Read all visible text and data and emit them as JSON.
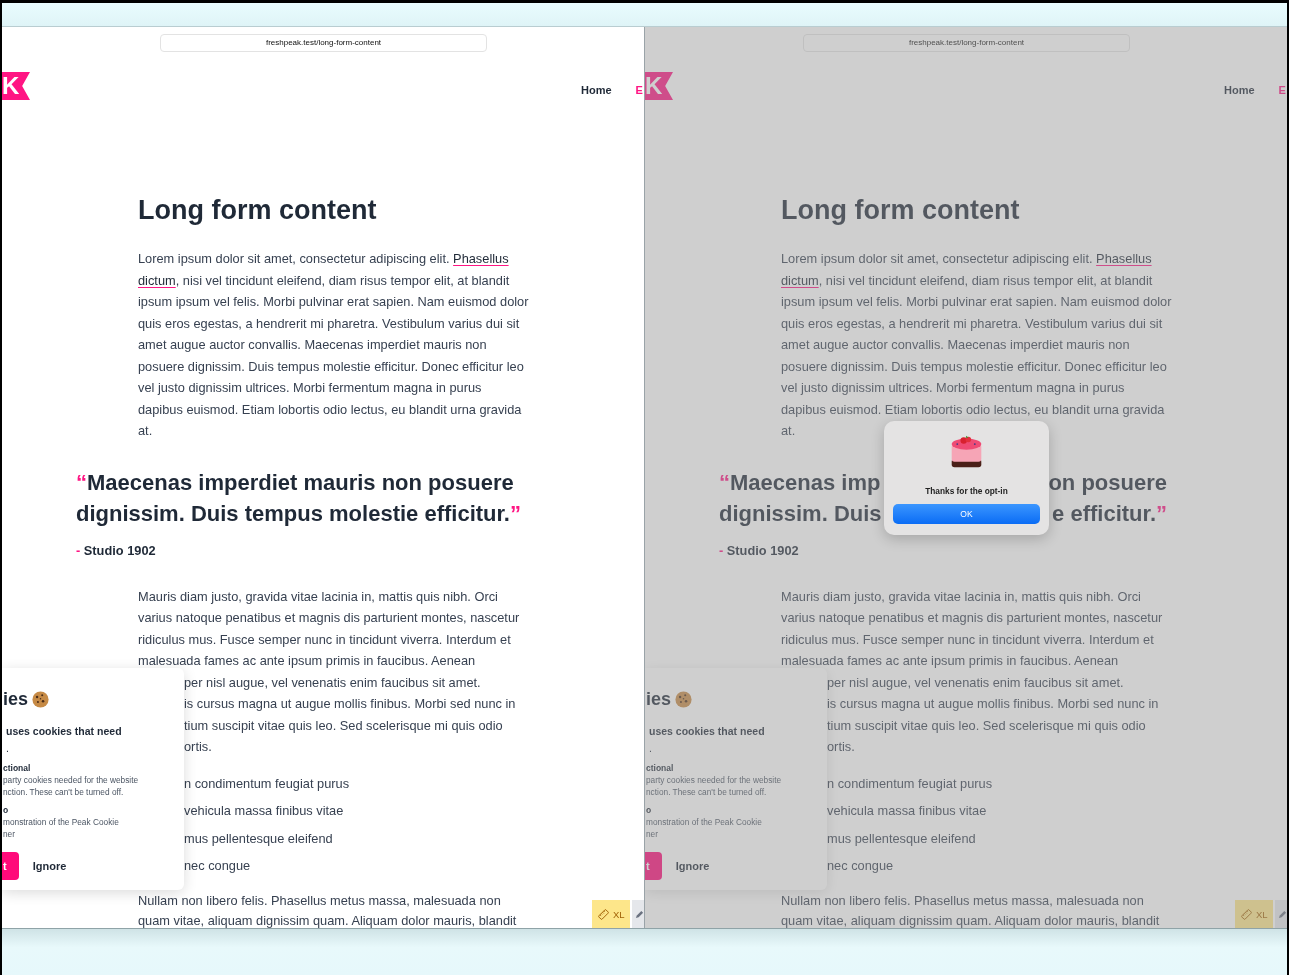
{
  "panes": [
    {
      "dimmed": false,
      "url": "freshpeak.test/long-form-content",
      "logo": "K",
      "nav": [
        {
          "label": "Home",
          "kind": "plain"
        },
        {
          "label": "E",
          "kind": "accent"
        }
      ],
      "title": "Long form content",
      "intro": [
        [
          {
            "text": "Lorem ipsum dolor sit amet, consectetur adipiscing elit. ",
            "link": false
          },
          {
            "text": "Phasellus",
            "link": true
          }
        ],
        [
          {
            "text": "dictum",
            "link": true
          },
          {
            "text": ", nisi vel tincidunt eleifend, diam risus tempor elit, at blandit",
            "link": false
          }
        ],
        [
          {
            "text": "ipsum ipsum vel felis. Morbi pulvinar erat sapien. Nam euismod dolor",
            "link": false
          }
        ],
        [
          {
            "text": "quis eros egestas, a hendrerit mi pharetra. Vestibulum varius dui sit",
            "link": false
          }
        ],
        [
          {
            "text": "amet augue auctor convallis. Maecenas imperdiet mauris non",
            "link": false
          }
        ],
        [
          {
            "text": "posuere dignissim. Duis tempus molestie efficitur. Donec efficitur leo",
            "link": false
          }
        ],
        [
          {
            "text": "vel justo dignissim ultrices. Morbi fermentum magna in purus",
            "link": false
          }
        ],
        [
          {
            "text": "dapibus euismod. Etiam lobortis odio lectus, eu blandit urna gravida",
            "link": false
          }
        ],
        [
          {
            "text": "at.",
            "link": false
          }
        ]
      ],
      "quote": [
        {
          "open": "“",
          "segments": [
            "Maecenas imperdiet mauris non posuere"
          ]
        },
        {
          "segments": [
            "dignissim. Duis tempus molestie efficitur."
          ],
          "close": "”"
        }
      ],
      "attribution": {
        "dash": "-",
        "name": "Studio 1902"
      },
      "body": [
        "Mauris diam justo, gravida vitae lacinia in, mattis quis nibh. Orci",
        "varius natoque penatibus et magnis dis parturient montes, nascetur",
        "ridiculus mus. Fusce semper nunc in tincidunt viverra. Interdum et",
        "malesuada fames ac ante ipsum primis in faucibus. Aenean"
      ],
      "fragments": [
        "per nisl augue, vel venenatis enim faucibus sit amet.",
        "is cursus magna ut augue mollis finibus. Morbi sed nunc in",
        "tium suscipit vitae quis leo. Sed scelerisque mi quis odio",
        "ortis."
      ],
      "list": [
        "n condimentum feugiat purus",
        "vehicula massa finibus vitae",
        "mus pellentesque eleifend",
        "nec congue"
      ],
      "outro": [
        "Nullam non libero felis. Phasellus metus massa, malesuada non",
        "quam vitae, aliquam dignissim quam. Aliquam dolor mauris, blandit"
      ],
      "cookie_banner": {
        "title": "ies",
        "lead": "uses cookies that need",
        "lead_more": ".",
        "groups": [
          {
            "name": "ctional",
            "lines": [
              "party cookies needed for the website",
              "nction. These can't be turned off."
            ]
          },
          {
            "name": "o",
            "lines": [
              "monstration of the Peak Cookie",
              "ner"
            ]
          }
        ],
        "accept": "t",
        "ignore": "Ignore"
      },
      "badges": [
        {
          "kind": "size",
          "label": "XL"
        },
        {
          "kind": "pencil"
        }
      ]
    },
    {
      "dimmed": true,
      "url": "freshpeak.test/long-form-content",
      "logo": "K",
      "nav": [
        {
          "label": "Home",
          "kind": "plain"
        },
        {
          "label": "E",
          "kind": "accent"
        }
      ],
      "title": "Long form content",
      "intro": [
        [
          {
            "text": "Lorem ipsum dolor sit amet, consectetur adipiscing elit. ",
            "link": false
          },
          {
            "text": "Phasellus",
            "link": true
          }
        ],
        [
          {
            "text": "dictum",
            "link": true
          },
          {
            "text": ", nisi vel tincidunt eleifend, diam risus tempor elit, at blandit",
            "link": false
          }
        ],
        [
          {
            "text": "ipsum ipsum vel felis. Morbi pulvinar erat sapien. Nam euismod dolor",
            "link": false
          }
        ],
        [
          {
            "text": "quis eros egestas, a hendrerit mi pharetra. Vestibulum varius dui sit",
            "link": false
          }
        ],
        [
          {
            "text": "amet augue auctor convallis. Maecenas imperdiet mauris non",
            "link": false
          }
        ],
        [
          {
            "text": "posuere dignissim. Duis tempus molestie efficitur. Donec efficitur leo",
            "link": false
          }
        ],
        [
          {
            "text": "vel justo dignissim ultrices. Morbi fermentum magna in purus",
            "link": false
          }
        ],
        [
          {
            "text": "dapibus euismod. Etiam lobortis odio lectus, eu blandit urna gravida",
            "link": false
          }
        ],
        [
          {
            "text": "at.",
            "link": false
          }
        ]
      ],
      "quote": [
        {
          "open": "“",
          "segments": [
            "Maecenas imp",
            "on posuere"
          ]
        },
        {
          "segments": [
            "dignissim. Duis",
            "e efficitur."
          ],
          "close": "”"
        }
      ],
      "attribution": {
        "dash": "-",
        "name": "Studio 1902"
      },
      "body": [
        "Mauris diam justo, gravida vitae lacinia in, mattis quis nibh. Orci",
        "varius natoque penatibus et magnis dis parturient montes, nascetur",
        "ridiculus mus. Fusce semper nunc in tincidunt viverra. Interdum et",
        "malesuada fames ac ante ipsum primis in faucibus. Aenean"
      ],
      "fragments": [
        "per nisl augue, vel venenatis enim faucibus sit amet.",
        "is cursus magna ut augue mollis finibus. Morbi sed nunc in",
        "tium suscipit vitae quis leo. Sed scelerisque mi quis odio",
        "ortis."
      ],
      "list": [
        "n condimentum feugiat purus",
        "vehicula massa finibus vitae",
        "mus pellentesque eleifend",
        "nec congue"
      ],
      "outro": [
        "Nullam non libero felis. Phasellus metus massa, malesuada non",
        "quam vitae, aliquam dignissim quam. Aliquam dolor mauris, blandit"
      ],
      "cookie_banner": {
        "title": "ies",
        "lead": "uses cookies that need",
        "lead_more": ".",
        "groups": [
          {
            "name": "ctional",
            "lines": [
              "party cookies needed for the website",
              "nction. These can't be turned off."
            ]
          },
          {
            "name": "o",
            "lines": [
              "monstration of the Peak Cookie",
              "ner"
            ]
          }
        ],
        "accept": "t",
        "ignore": "Ignore"
      },
      "badges": [
        {
          "kind": "size",
          "label": "XL"
        },
        {
          "kind": "pencil"
        }
      ],
      "dialog": {
        "message": "Thanks for the opt-in",
        "button": "OK"
      }
    }
  ]
}
